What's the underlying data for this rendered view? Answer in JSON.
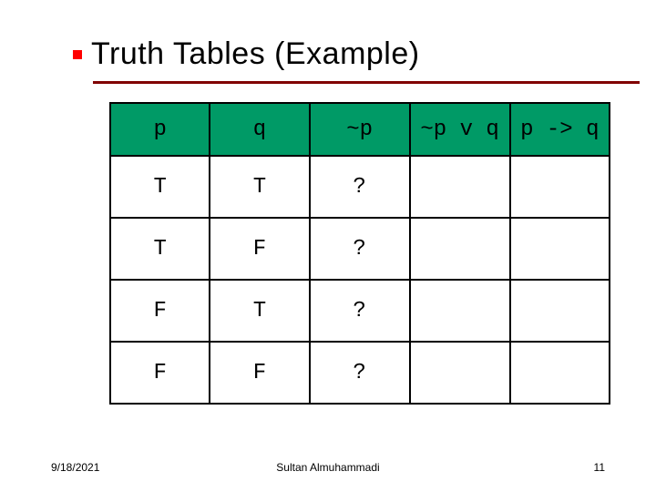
{
  "title": "Truth Tables (Example)",
  "table": {
    "headers": [
      "p",
      "q",
      "~p",
      "~p v q",
      "p -> q"
    ],
    "rows": [
      [
        "T",
        "T",
        "?",
        "",
        ""
      ],
      [
        "T",
        "F",
        "?",
        "",
        ""
      ],
      [
        "F",
        "T",
        "?",
        "",
        ""
      ],
      [
        "F",
        "F",
        "?",
        "",
        ""
      ]
    ]
  },
  "footer": {
    "date": "9/18/2021",
    "author": "Sultan Almuhammadi",
    "page": "11"
  },
  "chart_data": {
    "type": "table",
    "title": "Truth Tables (Example)",
    "columns": [
      "p",
      "q",
      "~p",
      "~p v q",
      "p -> q"
    ],
    "rows": [
      {
        "p": "T",
        "q": "T",
        "~p": "?",
        "~p v q": "",
        "p -> q": ""
      },
      {
        "p": "T",
        "q": "F",
        "~p": "?",
        "~p v q": "",
        "p -> q": ""
      },
      {
        "p": "F",
        "q": "T",
        "~p": "?",
        "~p v q": "",
        "p -> q": ""
      },
      {
        "p": "F",
        "q": "F",
        "~p": "?",
        "~p v q": "",
        "p -> q": ""
      }
    ]
  }
}
